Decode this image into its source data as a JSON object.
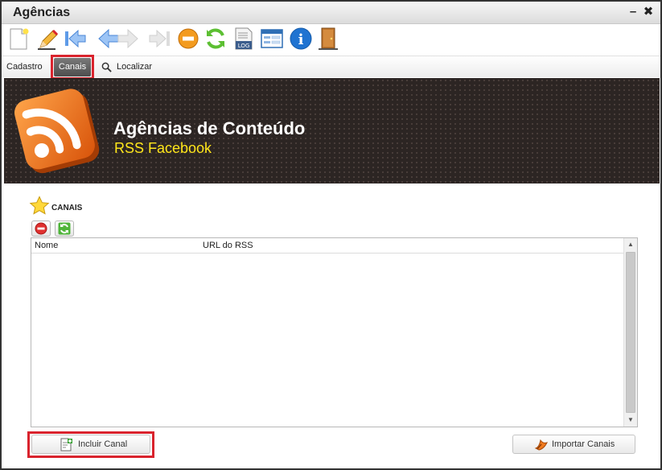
{
  "window": {
    "title": "Agências",
    "minimize_label": "–",
    "close_label": "✖"
  },
  "toolbar": {
    "buttons": [
      "new-document-icon",
      "edit-pencil-icon",
      "first-record-icon",
      "previous-record-icon",
      "next-record-icon",
      "last-record-icon",
      "delete-icon",
      "refresh-icon",
      "log-icon",
      "form-view-icon",
      "info-icon",
      "exit-door-icon"
    ],
    "log_label": "LOG",
    "info_label": "i"
  },
  "tabs": {
    "cadastro": "Cadastro",
    "canais": "Canais",
    "localizar": "Localizar"
  },
  "banner": {
    "title": "Agências de Conteúdo",
    "subtitle": "RSS Facebook"
  },
  "section": {
    "title": "CANAIS"
  },
  "grid": {
    "columns": [
      "Nome",
      "URL do RSS"
    ],
    "rows": []
  },
  "buttons": {
    "incluir": "Incluir Canal",
    "importar": "Importar Canais"
  },
  "colors": {
    "highlight": "#d9232d",
    "banner_bg": "#2c2523",
    "banner_subtitle": "#ffe61a",
    "rss_orange": "#f07a1e"
  }
}
